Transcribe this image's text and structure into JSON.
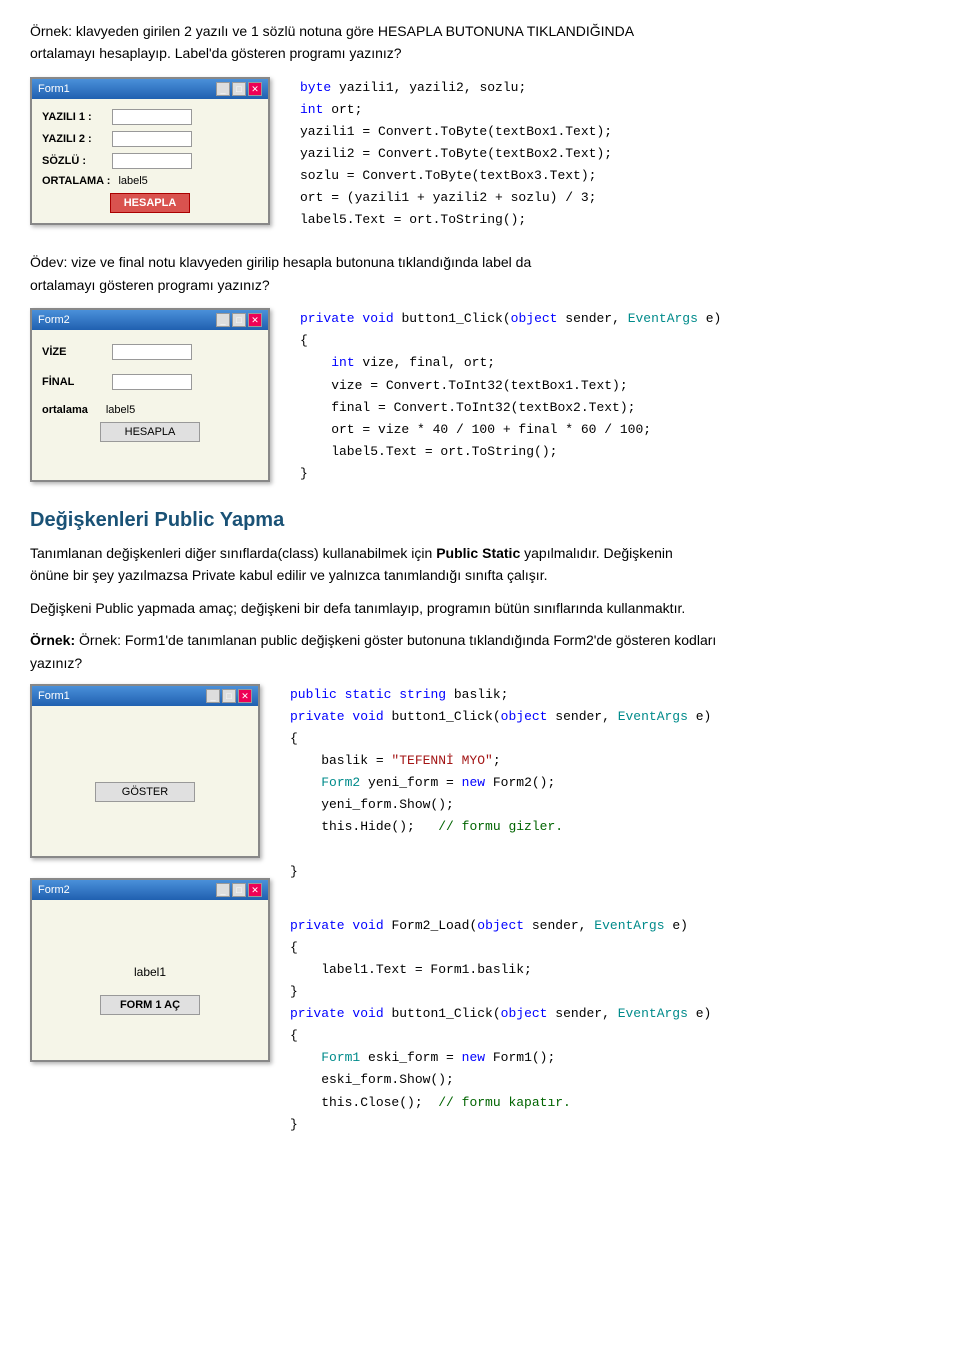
{
  "intro": {
    "line1": "Örnek: klavyeden girilen 2 yazılı ve 1 sözlü notuna göre HESAPLA BUTONUNA TIKLANDIĞINDA",
    "line2": "ortalamayı hesaplayıp. Label'da gösteren programı yazınız?"
  },
  "form1": {
    "title": "Form1",
    "fields": [
      {
        "label": "YAZILI 1 :",
        "type": "input"
      },
      {
        "label": "YAZILI 2 :",
        "type": "input"
      },
      {
        "label": "SÖZLÜ :",
        "type": "input"
      }
    ],
    "ortalama_label": "ORTALAMA :",
    "ortalama_value": "label5",
    "button": "HESAPLA"
  },
  "code1": {
    "lines": [
      {
        "text": "byte",
        "type": "keyword-blue",
        "rest": " yazili1, yazili2, sozlu;"
      },
      {
        "text": "int",
        "type": "keyword-blue",
        "rest": " ort;"
      },
      {
        "text": "yazili1 = Convert.ToByte(textBox1.Text);"
      },
      {
        "text": "yazili2 = Convert.ToByte(textBox2.Text);"
      },
      {
        "text": "sozlu = Convert.ToByte(textBox3.Text);"
      },
      {
        "text": "ort = (yazili1 + yazili2 + sozlu) / 3;"
      },
      {
        "text": "label5.Text = ort.ToString();"
      }
    ]
  },
  "odev_text": {
    "line1": "Ödev: vize ve final notu klavyeden girilip hesapla butonuna tıklandığında label da",
    "line2": "ortalamayı gösteren programı yazınız?"
  },
  "form2": {
    "title": "Form2",
    "fields": [
      {
        "label": "VİZE",
        "type": "input"
      },
      {
        "label": "FİNAL",
        "type": "input"
      }
    ],
    "ortalama_label": "ortalama",
    "ortalama_value": "label5",
    "button": "HESAPLA"
  },
  "code2_heading": "private void button1_Click(object sender, EventArgs e)",
  "code2": {
    "lines": [
      "int vize, final, ort;",
      "vize = Convert.ToInt32(textBox1.Text);",
      "final = Convert.ToInt32(textBox2.Text);",
      "ort = vize * 40 / 100 + final * 60 / 100;",
      "label5.Text = ort.ToString();"
    ]
  },
  "section_heading": "Değişkenleri Public Yapma",
  "section_text1": "Tanımlanan değişkenleri diğer sınıflarda(class) kullanabilmek için ",
  "section_bold": "Public Static",
  "section_text2": " yapılmalıdır. Değişkenin",
  "section_text3": "önüne bir şey yazılmazsa Private kabul edilir ve yalnızca tanımlandığı sınıfta çalışır.",
  "section_text4": "Değişkeni Public yapmada amaç; değişkeni bir defa tanımlayıp, programın bütün sınıflarında kullanmaktır.",
  "example2_text": "Örnek: Form1'de tanımlanan public değişkeni göster butonuna tıklandığında Form2'de gösteren kodları",
  "example2_text2": "yazınız?",
  "form_show": {
    "title": "Form1",
    "button": "GÖSTER"
  },
  "form2_bottom": {
    "title": "Form2",
    "label": "label1",
    "button": "FORM 1 AÇ"
  },
  "code3": [
    {
      "kw": "public",
      "rest": " ",
      "kw2": "static",
      "rest2": " ",
      "kw3": "string",
      "rest3": " baslik;"
    },
    {
      "kw": "private",
      "rest": " ",
      "kw2": "void",
      "rest2": " button1_Click(",
      "kw3": "object",
      "rest3": " sender, ",
      "type4": "cyan",
      "kw4": "EventArgs",
      "rest4": " e)"
    },
    "{",
    "    baslik = \"TEFENNİ MYO\";",
    "    Form2 yeni_form = new Form2();",
    "    yeni_form.Show();",
    "    this.Hide();   // formu gizler.",
    "}"
  ],
  "code4": [
    {
      "line": "private void Form2_Load(object sender, EventArgs e)"
    },
    {
      "line": "{"
    },
    {
      "line": "    label1.Text = Form1.baslik;"
    },
    {
      "line": "}"
    },
    {
      "line": "private void button1_Click(object sender, EventArgs e)"
    },
    {
      "line": "{"
    },
    {
      "line": "    Form1 eski_form = new Form1();"
    },
    {
      "line": "    eski_form.Show();"
    },
    {
      "line": "    this.Close();  // formu kapatır."
    },
    {
      "line": "}"
    }
  ]
}
